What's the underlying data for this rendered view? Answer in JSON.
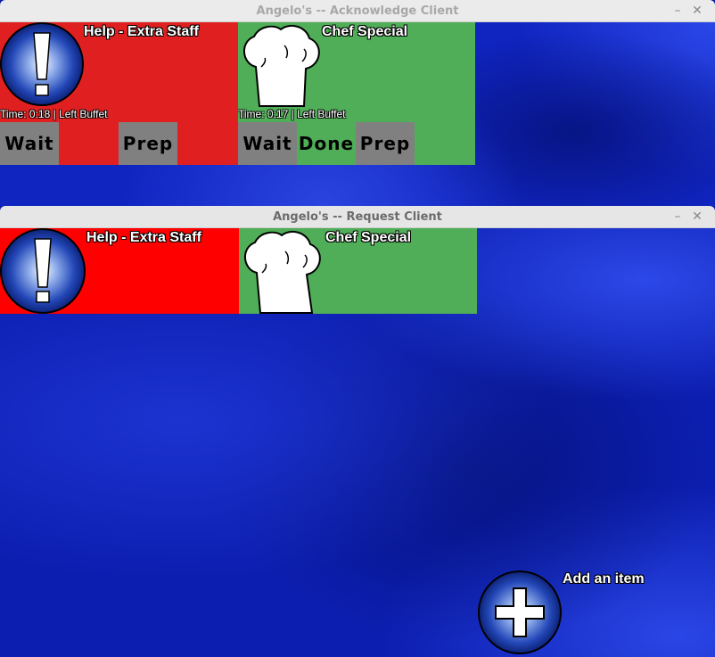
{
  "acknowledge_window": {
    "title": "Angelo's -- Acknowledge Client",
    "minimize_glyph": "–",
    "close_glyph": "✕",
    "cards": [
      {
        "title": "Help - Extra Staff",
        "time_text": "Time: 0:18 | Left Buffet",
        "icon": "exclamation-icon",
        "color": "#e02020",
        "buttons": [
          "Wait",
          "Prep"
        ]
      },
      {
        "title": "Chef Special",
        "time_text": "Time: 0:17 | Left Buffet",
        "icon": "chef-hat-icon",
        "color": "#4fae57",
        "buttons": [
          "Wait",
          "Done",
          "Prep"
        ]
      }
    ]
  },
  "request_window": {
    "title": "Angelo's -- Request Client",
    "minimize_glyph": "–",
    "close_glyph": "✕",
    "cards": [
      {
        "title": "Help - Extra Staff",
        "icon": "exclamation-icon",
        "color": "#ff0000"
      },
      {
        "title": "Chef Special",
        "icon": "chef-hat-icon",
        "color": "#4fae57"
      }
    ],
    "add_item_label": "Add an item",
    "add_item_icon": "plus-icon"
  }
}
